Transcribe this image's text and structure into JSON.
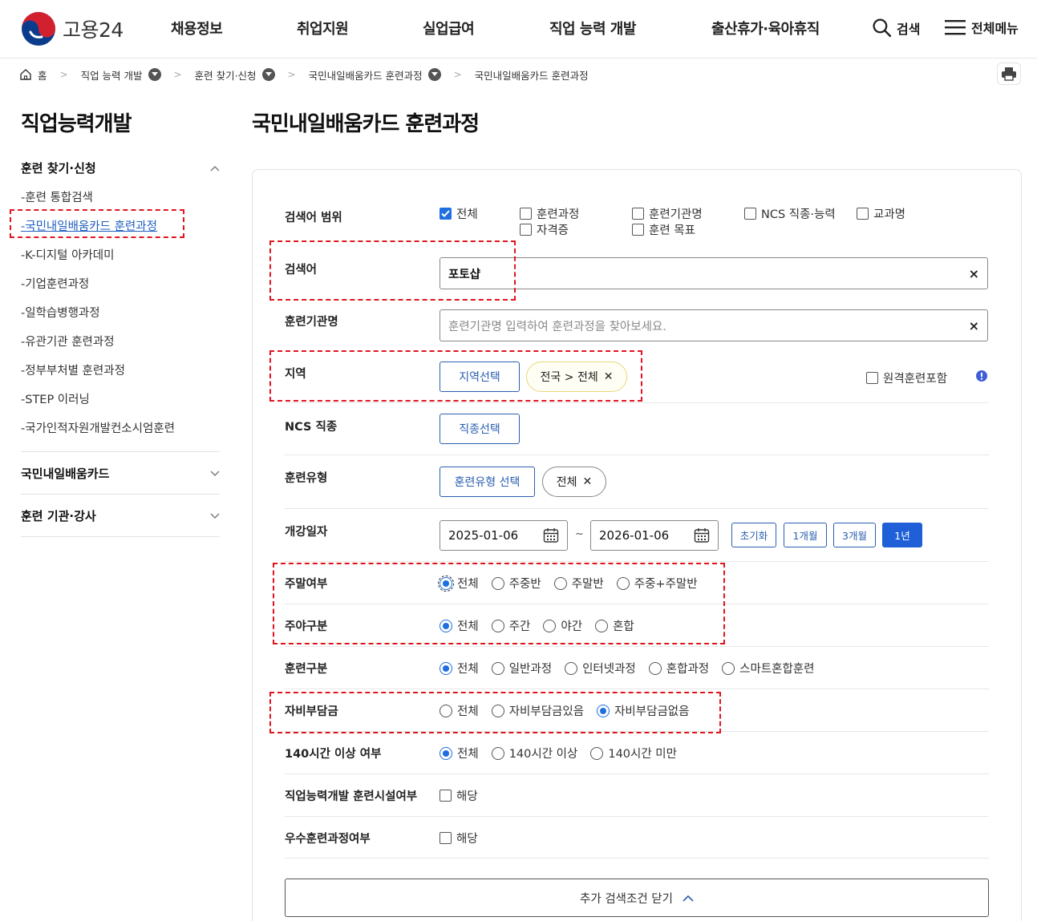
{
  "header": {
    "logo_text": "고용24",
    "nav": [
      "채용정보",
      "취업지원",
      "실업급여",
      "직업 능력 개발",
      "출산휴가·육아휴직"
    ],
    "search_label": "검색",
    "menu_label": "전체메뉴"
  },
  "breadcrumb": [
    "홈",
    "직업 능력 개발",
    "훈련 찾기·신청",
    "국민내일배움카드 훈련과정",
    "국민내일배움카드 훈련과정"
  ],
  "sidebar": {
    "title": "직업능력개발",
    "group1": "훈련 찾기·신청",
    "items": [
      "훈련 통합검색",
      "국민내일배움카드 훈련과정",
      "K-디지털 아카데미",
      "기업훈련과정",
      "일학습병행과정",
      "유관기관 훈련과정",
      "정부부처별 훈련과정",
      "STEP 이러닝",
      "국가인적자원개발컨소시엄훈련"
    ],
    "group2": "국민내일배움카드",
    "group3": "훈련 기관·강사"
  },
  "main": {
    "title": "국민내일배움카드 훈련과정",
    "scope": {
      "label": "검색어 범위",
      "options": [
        "전체",
        "훈련과정",
        "훈련기관명",
        "NCS 직종·능력",
        "교과명",
        "자격증",
        "훈련 목표"
      ]
    },
    "keyword": {
      "label": "검색어",
      "value": "포토샵",
      "clear": "×"
    },
    "institute": {
      "label": "훈련기관명",
      "placeholder": "훈련기관명 입력하여 훈련과정을 찾아보세요.",
      "clear": "×"
    },
    "region": {
      "label": "지역",
      "button": "지역선택",
      "tag": "전국 > 전체",
      "remote": "원격훈련포함"
    },
    "ncs": {
      "label": "NCS 직종",
      "button": "직종선택"
    },
    "type": {
      "label": "훈련유형",
      "button": "훈련유형 선택",
      "tag": "전체"
    },
    "date": {
      "label": "개강일자",
      "start": "2025-01-06",
      "end": "2026-01-06",
      "tilde": "~",
      "periods": [
        "초기화",
        "1개월",
        "3개월",
        "1년"
      ]
    },
    "weekend": {
      "label": "주말여부",
      "options": [
        "전체",
        "주중반",
        "주말반",
        "주중+주말반"
      ]
    },
    "daynight": {
      "label": "주야구분",
      "options": [
        "전체",
        "주간",
        "야간",
        "혼합"
      ]
    },
    "category": {
      "label": "훈련구분",
      "options": [
        "전체",
        "일반과정",
        "인터넷과정",
        "혼합과정",
        "스마트혼합훈련"
      ]
    },
    "selfpay": {
      "label": "자비부담금",
      "options": [
        "전체",
        "자비부담금있음",
        "자비부담금없음"
      ]
    },
    "hours": {
      "label": "140시간 이상 여부",
      "options": [
        "전체",
        "140시간 이상",
        "140시간 미만"
      ]
    },
    "facility": {
      "label": "직업능력개발 훈련시설여부",
      "option": "해당"
    },
    "excellent": {
      "label": "우수훈련과정여부",
      "option": "해당"
    },
    "more_button": "추가 검색조건 닫기"
  },
  "colors": {
    "accent": "#1f5fd8",
    "highlight": "#e0141e"
  }
}
